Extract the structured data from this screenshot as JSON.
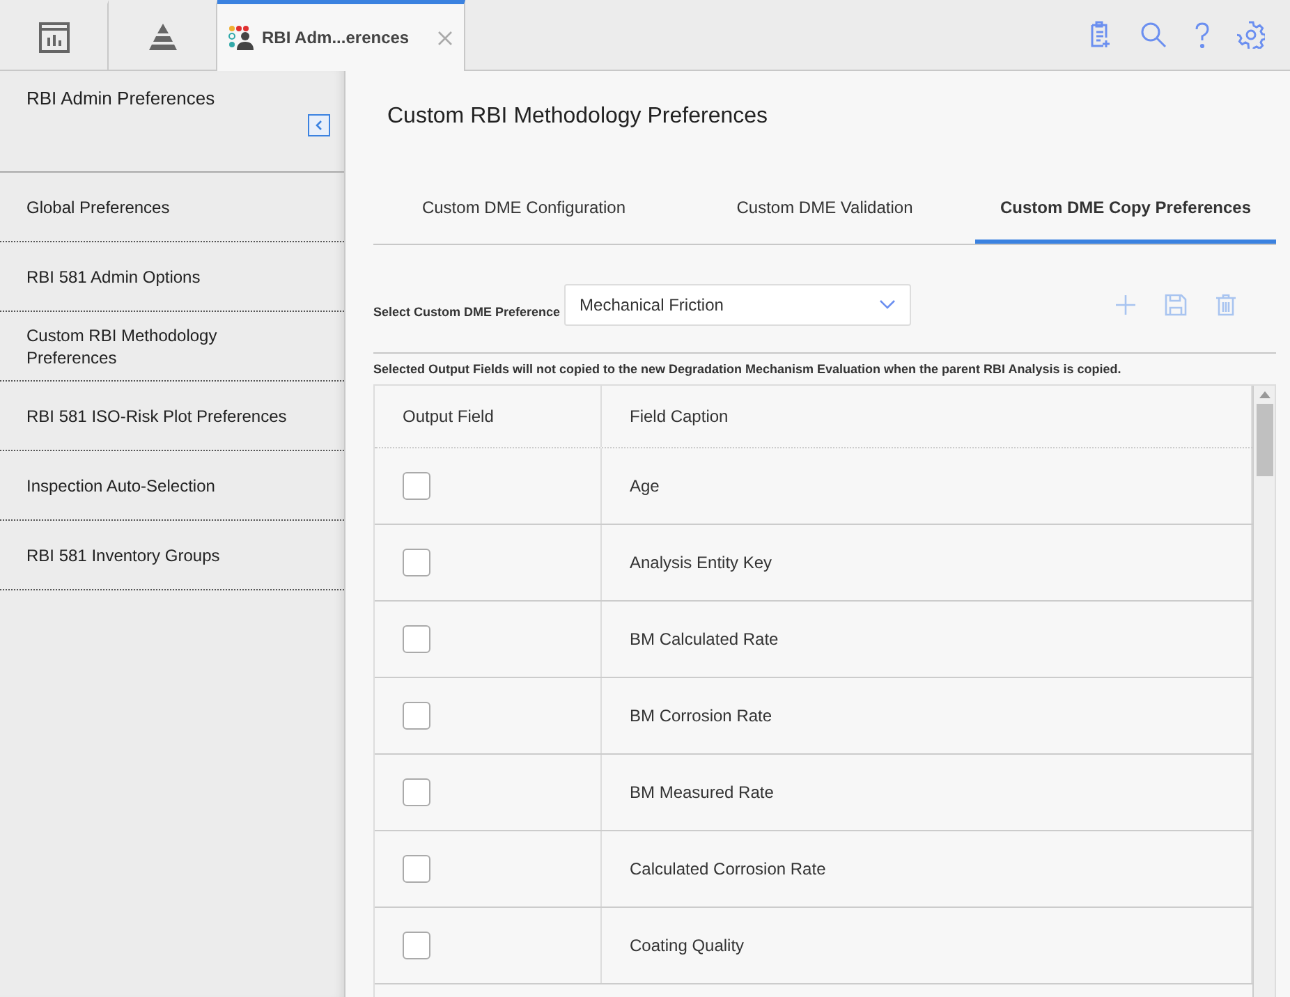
{
  "top_tabs": [
    {
      "kind": "icon",
      "selected": false
    },
    {
      "kind": "icon",
      "selected": false
    },
    {
      "kind": "page",
      "label": "RBI Adm...erences",
      "selected": true
    }
  ],
  "sidebar": {
    "title": "RBI Admin Preferences",
    "items": [
      {
        "label": "Global Preferences"
      },
      {
        "label": "RBI 581 Admin Options"
      },
      {
        "label": "Custom RBI Methodology Preferences"
      },
      {
        "label": "RBI 581 ISO-Risk Plot Preferences"
      },
      {
        "label": "Inspection Auto-Selection"
      },
      {
        "label": "RBI 581 Inventory Groups"
      }
    ]
  },
  "page_title": "Custom RBI Methodology Preferences",
  "tabs": [
    {
      "label": "Custom DME Configuration",
      "selected": false
    },
    {
      "label": "Custom DME Validation",
      "selected": false
    },
    {
      "label": "Custom DME Copy Preferences",
      "selected": true
    }
  ],
  "preference_select": {
    "label": "Select Custom DME Preference",
    "value": "Mechanical Friction"
  },
  "notice": "Selected Output Fields will not copied to the new Degradation Mechanism Evaluation when the parent RBI Analysis is copied.",
  "table": {
    "columns": [
      "Output Field",
      "Field Caption"
    ],
    "rows": [
      {
        "checked": false,
        "caption": "Age"
      },
      {
        "checked": false,
        "caption": "Analysis Entity Key"
      },
      {
        "checked": false,
        "caption": "BM Calculated Rate"
      },
      {
        "checked": false,
        "caption": "BM Corrosion Rate"
      },
      {
        "checked": false,
        "caption": "BM Measured Rate"
      },
      {
        "checked": false,
        "caption": "Calculated Corrosion Rate"
      },
      {
        "checked": false,
        "caption": "Coating Quality"
      }
    ]
  }
}
